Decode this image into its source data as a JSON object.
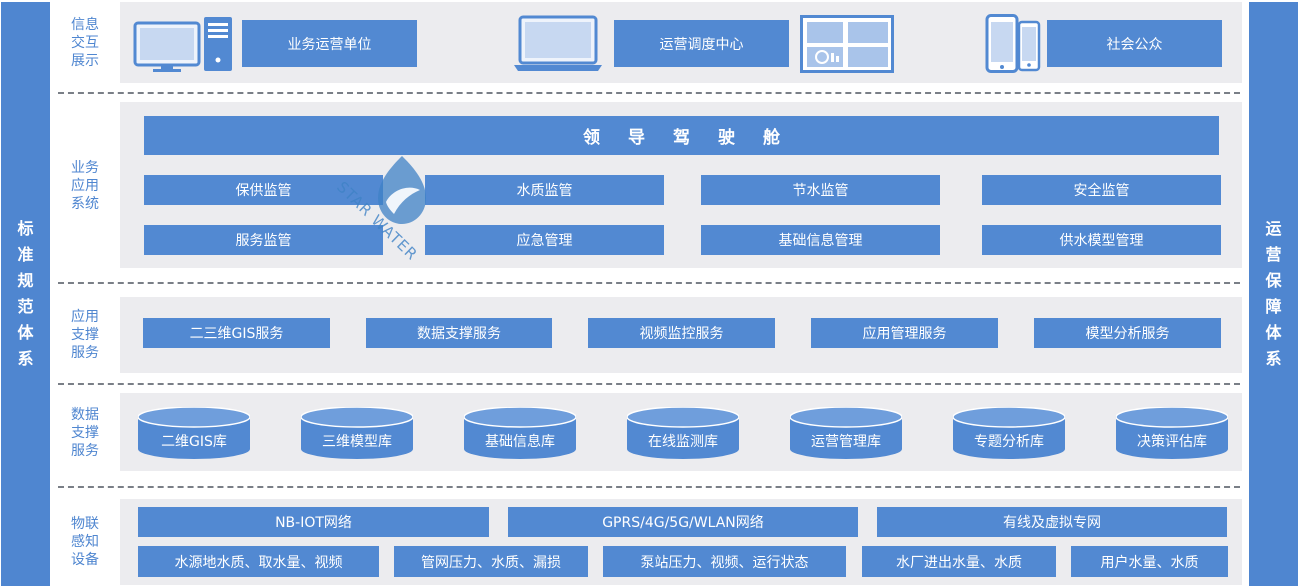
{
  "left_side": [
    "标",
    "准",
    "规",
    "范",
    "体",
    "系"
  ],
  "right_side": [
    "运",
    "营",
    "保",
    "障",
    "体",
    "系"
  ],
  "layers": [
    {
      "label": [
        "信息",
        "交互",
        "展示"
      ]
    },
    {
      "label": [
        "业务",
        "应用",
        "系统"
      ]
    },
    {
      "label": [
        "应用",
        "支撑",
        "服务"
      ]
    },
    {
      "label": [
        "数据",
        "支撑",
        "服务"
      ]
    },
    {
      "label": [
        "物联",
        "感知",
        "设备"
      ]
    }
  ],
  "display": {
    "biz_unit": "业务运营单位",
    "dispatch_center": "运营调度中心",
    "public": "社会公众"
  },
  "business": {
    "cockpit": [
      "领",
      "导",
      "驾",
      "驶",
      "舱"
    ],
    "row1": [
      "保供监管",
      "水质监管",
      "节水监管",
      "安全监管"
    ],
    "row2": [
      "服务监管",
      "应急管理",
      "基础信息管理",
      "供水模型管理"
    ]
  },
  "app_support": [
    "二三维GIS服务",
    "数据支撑服务",
    "视频监控服务",
    "应用管理服务",
    "模型分析服务"
  ],
  "databases": [
    "二维GIS库",
    "三维模型库",
    "基础信息库",
    "在线监测库",
    "运营管理库",
    "专题分析库",
    "决策评估库"
  ],
  "iot": {
    "networks": [
      "NB-IOT网络",
      "GPRS/4G/5G/WLAN网络",
      "有线及虚拟专网"
    ],
    "devices": [
      "水源地水质、取水量、视频",
      "管网压力、水质、漏损",
      "泵站压力、视频、运行状态",
      "水厂进出水量、水质",
      "用户水量、水质"
    ]
  },
  "watermark": "STAR WATER",
  "colors": {
    "accent": "#5289d2",
    "side": "#4f86d0",
    "panel": "#ececef",
    "dash": "#7a7f87"
  }
}
